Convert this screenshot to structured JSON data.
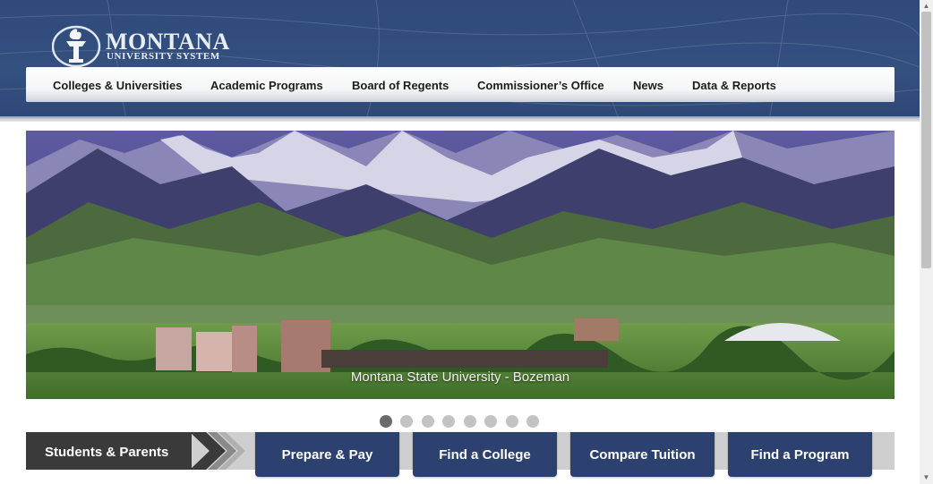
{
  "logo": {
    "name": "MONTANA",
    "subtitle": "UNIVERSITY SYSTEM"
  },
  "nav": {
    "items": [
      "Colleges & Universities",
      "Academic Programs",
      "Board of Regents",
      "Commissioner’s Office",
      "News",
      "Data & Reports"
    ]
  },
  "hero": {
    "caption": "Montana State University - Bozeman",
    "slides_total": 8,
    "active_slide": 1
  },
  "quicklinks": {
    "section_label": "Students & Parents",
    "buttons": [
      "Prepare & Pay",
      "Find a College",
      "Compare Tuition",
      "Find a Program"
    ]
  },
  "colors": {
    "header_blue": "#34507f",
    "button_navy": "#2c4170",
    "label_dark": "#3a3a3a"
  }
}
